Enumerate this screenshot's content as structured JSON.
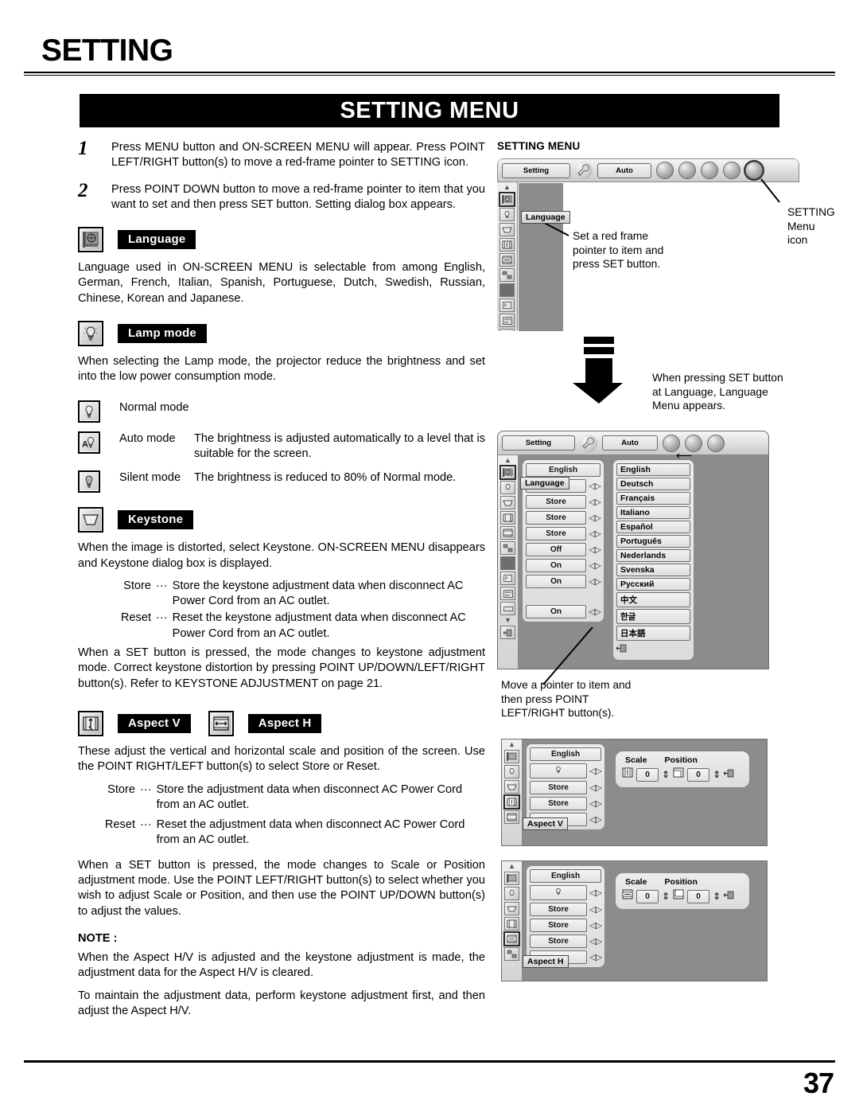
{
  "page": {
    "title": "SETTING",
    "banner": "SETTING MENU",
    "number": "37"
  },
  "steps": [
    {
      "num": "1",
      "text": "Press MENU button and ON-SCREEN MENU will appear.  Press POINT LEFT/RIGHT button(s) to move a red-frame pointer to SETTING icon."
    },
    {
      "num": "2",
      "text": "Press POINT DOWN button to move a red-frame pointer to item that you want to set and then press SET button.  Setting dialog box appears."
    }
  ],
  "sections": {
    "language": {
      "label": "Language",
      "icon": "language-flag-icon",
      "body": "Language used in ON-SCREEN MENU is selectable from among English, German, French, Italian, Spanish, Portuguese, Dutch, Swedish, Russian, Chinese, Korean and Japanese."
    },
    "lamp_mode": {
      "label": "Lamp mode",
      "icon": "lamp-bulb-icon",
      "body": "When selecting the Lamp mode, the projector reduce the brightness and set into the low power consumption mode.",
      "modes": [
        {
          "icon": "bulb-normal-icon",
          "name": "Normal mode",
          "desc": ""
        },
        {
          "icon": "bulb-auto-icon",
          "name": "Auto mode",
          "desc": "The brightness is adjusted automatically to a level that is suitable for the screen."
        },
        {
          "icon": "bulb-silent-icon",
          "name": "Silent mode",
          "desc": "The brightness is reduced to 80% of Normal mode."
        }
      ]
    },
    "keystone": {
      "label": "Keystone",
      "icon": "keystone-trapezoid-icon",
      "body": "When the image is distorted, select Keystone.  ON-SCREEN MENU disappears and Keystone dialog box is displayed.",
      "defs": [
        {
          "term": "Store",
          "dots": "···",
          "body": "Store the keystone adjustment data when disconnect AC Power Cord from an AC outlet."
        },
        {
          "term": "Reset",
          "dots": "···",
          "body": "Reset the keystone adjustment data when disconnect AC Power Cord from an AC outlet."
        }
      ],
      "after": "When a SET button is pressed, the mode changes to keystone adjustment mode. Correct keystone distortion by pressing POINT UP/DOWN/LEFT/RIGHT  button(s).  Refer  to  KEYSTONE ADJUSTMENT on page 21."
    },
    "aspect": {
      "label_v": "Aspect V",
      "label_h": "Aspect H",
      "icon_v": "aspect-vertical-icon",
      "icon_h": "aspect-horizontal-icon",
      "body": "These adjust the vertical and horizontal scale and position of the screen. Use the POINT RIGHT/LEFT button(s) to select Store or Reset.",
      "defs": [
        {
          "term": "Store",
          "dots": "···",
          "body": "Store the adjustment data when disconnect AC Power Cord from an AC outlet."
        },
        {
          "term": "Reset",
          "dots": "···",
          "body": "Reset the adjustment data when disconnect AC Power Cord from an AC outlet."
        }
      ],
      "after": "When a SET button is pressed, the mode changes to Scale or Position adjustment mode. Use the POINT LEFT/RIGHT button(s) to select whether you wish to adjust Scale or Position, and then use the POINT UP/DOWN button(s) to adjust the values."
    },
    "note": {
      "title": "NOTE :",
      "p1": "When the Aspect H/V is adjusted and the keystone adjustment is made, the adjustment data for the Aspect H/V is cleared.",
      "p2": "To maintain the adjustment data, perform keystone adjustment first, and then adjust the Aspect H/V."
    }
  },
  "right": {
    "heading": "SETTING MENU",
    "callouts": {
      "menu_icon": "SETTING Menu icon",
      "red_frame": "Set a red frame\npointer to item and\npress SET button.",
      "red_frame_l1": "Set a red frame",
      "red_frame_l2": "pointer to item and",
      "red_frame_l3": "press SET button.",
      "set_button_l1": "When pressing SET button",
      "set_button_l2": "at Language, Language",
      "set_button_l3": "Menu appears.",
      "move_pointer_l1": "Move a pointer to item and",
      "move_pointer_l2": "then press POINT",
      "move_pointer_l3": "LEFT/RIGHT button(s)."
    },
    "osd": {
      "bar": {
        "setting_label": "Setting",
        "auto_label": "Auto",
        "wrench_icon": "wrench-icon",
        "globe_icons": [
          "input-icon",
          "sound-icon",
          "screen-icon",
          "pc-adjust-icon",
          "setting-globe-icon"
        ]
      },
      "tooltip_language": "Language",
      "tooltip_aspect_v": "Aspect V",
      "tooltip_aspect_h": "Aspect H",
      "menu2_values": [
        "English",
        "Language",
        "Store",
        "Store",
        "Store",
        "Off",
        "On",
        "On",
        "On"
      ],
      "languages": [
        "English",
        "Deutsch",
        "Français",
        "Italiano",
        "Español",
        "Português",
        "Nederlands",
        "Svenska",
        "Русский",
        "中文",
        "한글",
        "日本語"
      ],
      "panel": {
        "scale_label": "Scale",
        "position_label": "Position",
        "scale_value": "0",
        "position_value": "0"
      },
      "menu3_values": [
        "English",
        "bulb",
        "Store",
        "Store",
        "Aspect V"
      ],
      "menu4_values": [
        "English",
        "bulb",
        "Store",
        "Store",
        "Store",
        "Aspect H"
      ]
    }
  }
}
